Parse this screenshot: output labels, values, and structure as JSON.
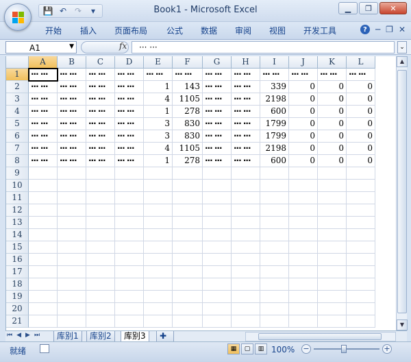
{
  "window": {
    "title": "Book1 - Microsoft Excel"
  },
  "qat": {
    "save_icon": "💾",
    "undo_icon": "↶",
    "redo_icon": "↷",
    "customize_icon": "▾"
  },
  "ribbon": {
    "tabs": [
      {
        "label": "开始"
      },
      {
        "label": "插入"
      },
      {
        "label": "页面布局"
      },
      {
        "label": "公式"
      },
      {
        "label": "数据"
      },
      {
        "label": "审阅"
      },
      {
        "label": "视图"
      },
      {
        "label": "开发工具"
      }
    ],
    "help_label": "?"
  },
  "formula": {
    "name_box": "A1",
    "fx": "fx",
    "content": "··· ···"
  },
  "grid": {
    "columns": [
      "A",
      "B",
      "C",
      "D",
      "E",
      "F",
      "G",
      "H",
      "I",
      "J",
      "K",
      "L"
    ],
    "rows": [
      [
        "··· ···",
        "··· ···",
        "··· ···",
        "··· ···",
        "··· ···",
        "··· ···",
        "··· ···",
        "··· ···",
        "··· ···",
        "··· ···",
        "··· ···",
        "··· ···"
      ],
      [
        "··· ···",
        "··· ···",
        "··· ···",
        "··· ···",
        "1",
        "143",
        "··· ···",
        "··· ···",
        "339",
        "0",
        "0",
        "0"
      ],
      [
        "··· ···",
        "··· ···",
        "··· ···",
        "··· ···",
        "4",
        "1105",
        "··· ···",
        "··· ···",
        "2198",
        "0",
        "0",
        "0"
      ],
      [
        "··· ···",
        "··· ···",
        "··· ···",
        "··· ···",
        "1",
        "278",
        "··· ···",
        "··· ···",
        "600",
        "0",
        "0",
        "0"
      ],
      [
        "··· ···",
        "··· ···",
        "··· ···",
        "··· ···",
        "3",
        "830",
        "··· ···",
        "··· ···",
        "1799",
        "0",
        "0",
        "0"
      ],
      [
        "··· ···",
        "··· ···",
        "··· ···",
        "··· ···",
        "3",
        "830",
        "··· ···",
        "··· ···",
        "1799",
        "0",
        "0",
        "0"
      ],
      [
        "··· ···",
        "··· ···",
        "··· ···",
        "··· ···",
        "4",
        "1105",
        "··· ···",
        "··· ···",
        "2198",
        "0",
        "0",
        "0"
      ],
      [
        "··· ···",
        "··· ···",
        "··· ···",
        "··· ···",
        "1",
        "278",
        "··· ···",
        "··· ···",
        "600",
        "0",
        "0",
        "0"
      ]
    ],
    "row_numbers": [
      "1",
      "2",
      "3",
      "4",
      "5",
      "6",
      "7",
      "8",
      "9",
      "10",
      "11",
      "12",
      "13",
      "14",
      "15",
      "16",
      "17",
      "18",
      "19",
      "20",
      "21"
    ]
  },
  "sheets": [
    {
      "label": "库别1"
    },
    {
      "label": "库别2"
    },
    {
      "label": "库别3",
      "active": true
    }
  ],
  "status": {
    "text": "就绪",
    "zoom": "100%"
  },
  "colors": {
    "accent": "#15428b",
    "selection": "#f1c05c"
  }
}
